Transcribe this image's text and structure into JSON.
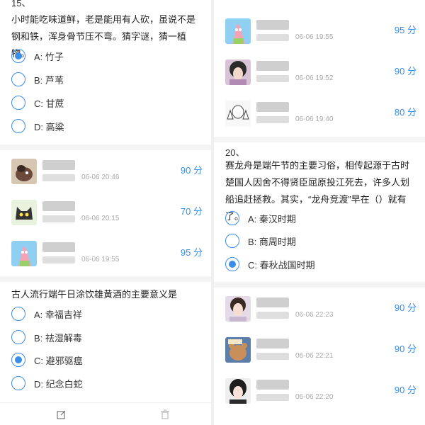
{
  "left": {
    "q15": {
      "number": "15、",
      "text": "小时能吃味道鲜，老是能用有人砍，虽说不是钢和铁，浑身骨节压不弯。猜字谜，猜一植物。",
      "options": [
        {
          "label": "A: 竹子",
          "selected": true
        },
        {
          "label": "B: 芦苇",
          "selected": false
        },
        {
          "label": "C: 甘蔗",
          "selected": false
        },
        {
          "label": "D: 高粱",
          "selected": false
        }
      ]
    },
    "answers": [
      {
        "time": "06-06 20:46",
        "score": "90 分",
        "avatar": "dog-avatar"
      },
      {
        "time": "06-06 20:15",
        "score": "70 分",
        "avatar": "cat-avatar"
      },
      {
        "time": "06-06 19:55",
        "score": "95 分",
        "avatar": "patrick-avatar"
      }
    ],
    "q_next": {
      "text": "古人流行端午日涂饮雄黄酒的主要意义是",
      "options": [
        {
          "label": "A: 幸福吉祥",
          "selected": false
        },
        {
          "label": "B: 祛湿解毒",
          "selected": false
        },
        {
          "label": "C: 避邪驱瘟",
          "selected": true
        },
        {
          "label": "D: 纪念白蛇",
          "selected": false
        }
      ]
    },
    "footer": {
      "edit_icon": "edit-icon",
      "delete_icon": "trash-icon"
    }
  },
  "right": {
    "answers_top": [
      {
        "time": "06-06 19:55",
        "score": "95 分",
        "avatar": "patrick-avatar"
      },
      {
        "time": "06-06 19:52",
        "score": "90 分",
        "avatar": "girl-avatar"
      },
      {
        "time": "06-06 19:40",
        "score": "80 分",
        "avatar": "thumbs-up-avatar"
      }
    ],
    "q20": {
      "number": "20、",
      "text": "赛龙舟是端午节的主要习俗，相传起源于古时楚国人因舍不得贤臣屈原投江死去，许多人划船追赶拯救。其实，“龙舟竞渡”早在（）就有了。",
      "options": [
        {
          "label": "A: 秦汉时期",
          "selected": false
        },
        {
          "label": "B: 商周时期",
          "selected": false
        },
        {
          "label": "C: 春秋战国时期",
          "selected": true
        }
      ]
    },
    "answers_bottom": [
      {
        "time": "06-06 22:23",
        "score": "90 分",
        "avatar": "girl2-avatar"
      },
      {
        "time": "06-06 22:21",
        "score": "90 分",
        "avatar": "bear-avatar"
      },
      {
        "time": "06-06 22:20",
        "score": "90 分",
        "avatar": "girl3-avatar"
      }
    ]
  },
  "colors": {
    "accent": "#3a8ee6",
    "muted": "#aaaaaa",
    "separator": "#f4f4f4"
  }
}
